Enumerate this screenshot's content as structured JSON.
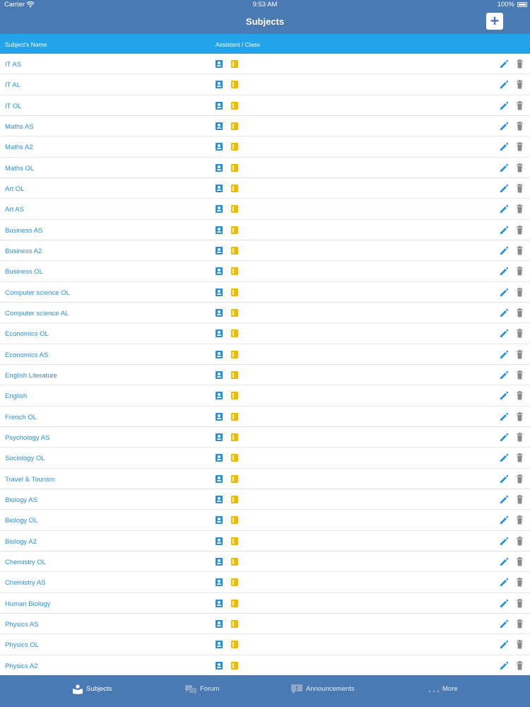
{
  "status_bar": {
    "carrier": "Carrier",
    "time": "9:53 AM",
    "battery": "100%"
  },
  "nav": {
    "title": "Subjects",
    "add_label": "+"
  },
  "table": {
    "columns": {
      "name": "Subject's Name",
      "assistant_class": "Assistant / Class"
    },
    "rows": [
      "IT AS",
      "IT AL",
      "IT OL",
      "Maths AS",
      "Maths A2",
      "Maths OL",
      "Art OL",
      "Art AS",
      "Business AS",
      "Business A2",
      "Business OL",
      "Computer science OL",
      "Computer science AL",
      "Economics OL",
      "Economics AS",
      "English Literature",
      "English",
      "French OL",
      "Psychology AS",
      "Sociology OL",
      "Travel & Tourism",
      "Biology AS",
      "Biology OL",
      "Biology A2",
      "Chemistry OL",
      "Chemistry AS",
      "Human Biology",
      "Physics AS",
      "Physics OL",
      "Physics A2"
    ]
  },
  "tabs": [
    {
      "label": "Subjects",
      "icon": "book-reader-icon",
      "active": true
    },
    {
      "label": "Forum",
      "icon": "chat-bubbles-icon",
      "active": false
    },
    {
      "label": "Announcements",
      "icon": "announcement-icon",
      "active": false
    },
    {
      "label": "More",
      "icon": "more-dots-icon",
      "active": false
    }
  ],
  "colors": {
    "nav_bar": "#4a7ab3",
    "table_header": "#23a3e9",
    "link_text": "#2a8fd6",
    "assistant_icon": "#2a8fd6",
    "class_icon": "#f5b800",
    "delete_icon": "#8a8a8a"
  }
}
